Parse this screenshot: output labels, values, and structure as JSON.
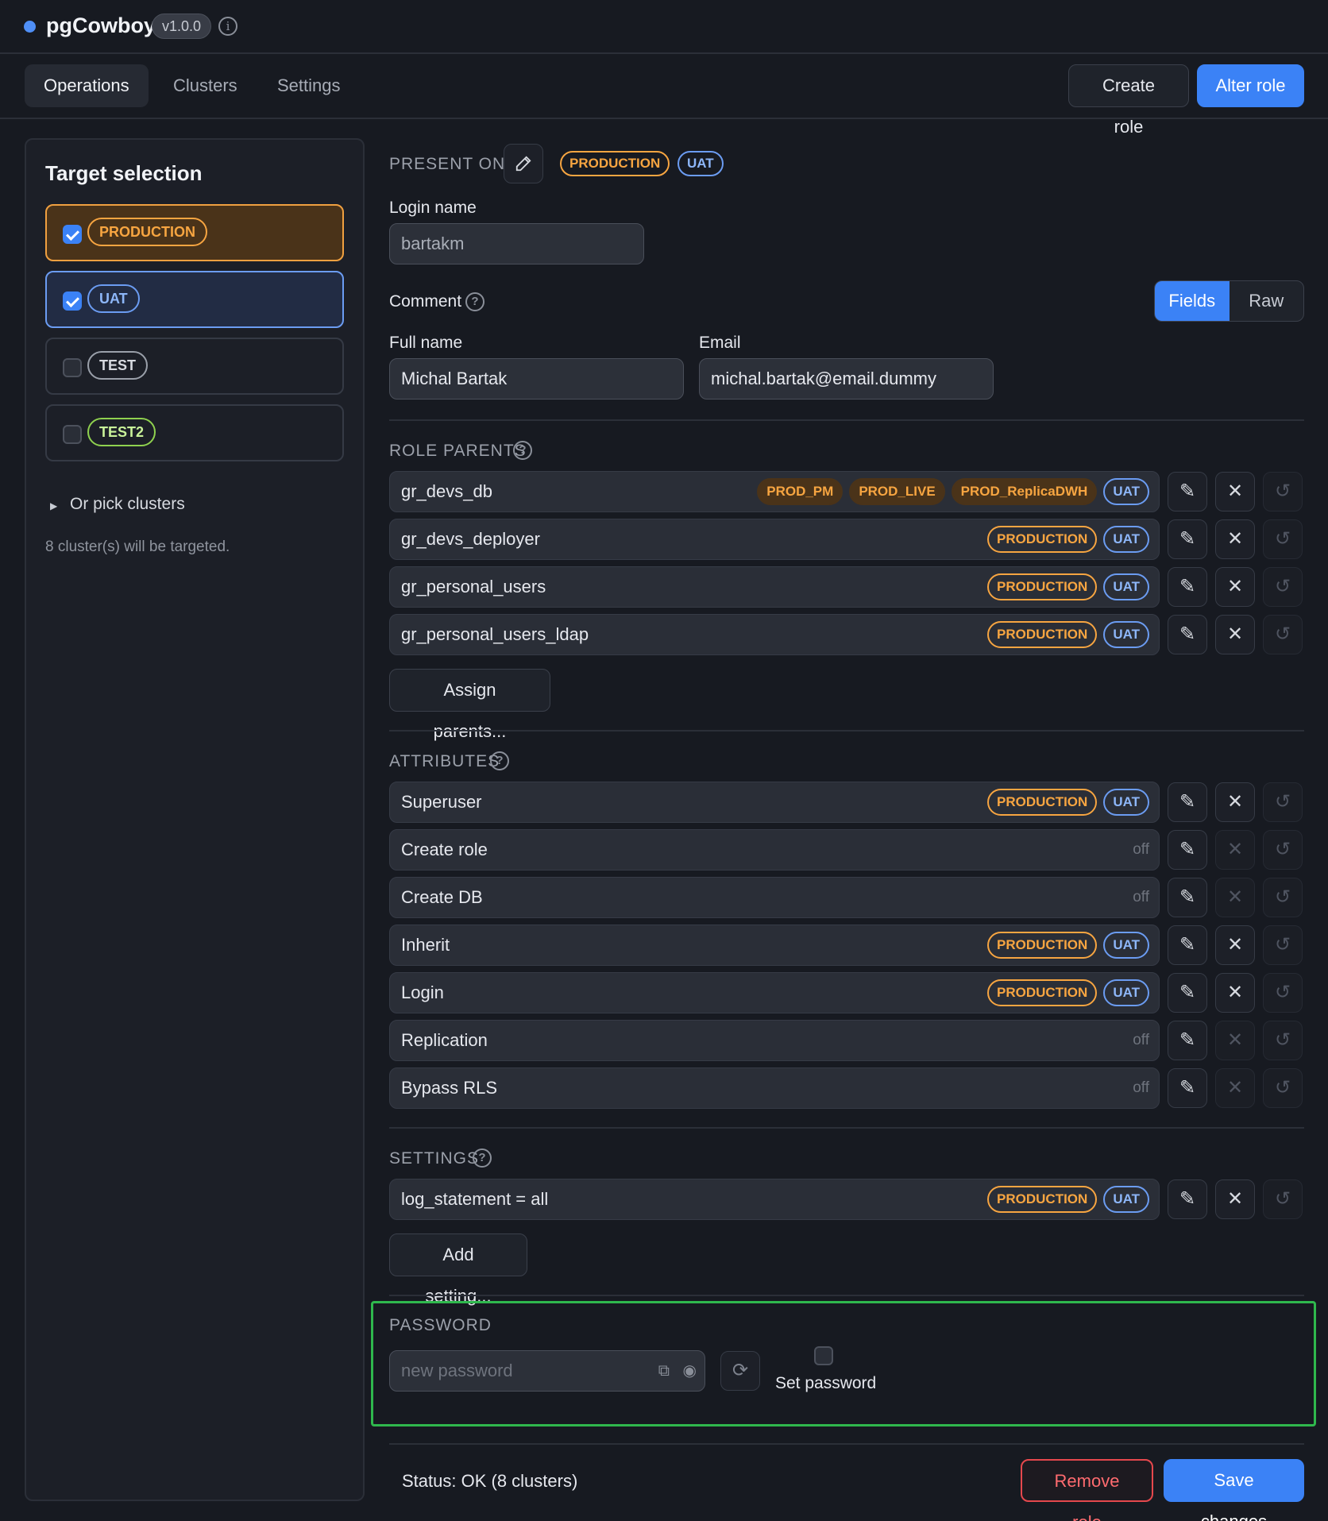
{
  "app": {
    "name": "pgCowboy",
    "version": "v1.0.0"
  },
  "nav": {
    "tabs": [
      "Operations",
      "Clusters",
      "Settings"
    ],
    "create_role": "Create role",
    "alter_role": "Alter role"
  },
  "target": {
    "title": "Target selection",
    "options": [
      {
        "label": "PRODUCTION",
        "checked": true
      },
      {
        "label": "UAT",
        "checked": true
      },
      {
        "label": "TEST",
        "checked": false
      },
      {
        "label": "TEST2",
        "checked": false
      }
    ],
    "pick_clusters": "Or pick clusters",
    "targeted_text": "8 cluster(s) will be targeted."
  },
  "form": {
    "present_on": {
      "label": "PRESENT ON",
      "chips": [
        "PRODUCTION",
        "UAT"
      ]
    },
    "login_name": {
      "label": "Login name",
      "value": "bartakm"
    },
    "comment": {
      "label": "Comment",
      "mode_fields": "Fields",
      "mode_raw": "Raw"
    },
    "full_name": {
      "label": "Full name",
      "value": "Michal Bartak"
    },
    "email": {
      "label": "Email",
      "value": "michal.bartak@email.dummy"
    }
  },
  "role_parents": {
    "label": "ROLE PARENTS",
    "items": [
      {
        "name": "gr_devs_db",
        "chips": [
          "PROD_PM",
          "PROD_LIVE",
          "PROD_ReplicaDWH",
          "UAT"
        ]
      },
      {
        "name": "gr_devs_deployer",
        "chips": [
          "PRODUCTION",
          "UAT"
        ]
      },
      {
        "name": "gr_personal_users",
        "chips": [
          "PRODUCTION",
          "UAT"
        ]
      },
      {
        "name": "gr_personal_users_ldap",
        "chips": [
          "PRODUCTION",
          "UAT"
        ]
      }
    ],
    "assign_button": "Assign parents..."
  },
  "attributes": {
    "label": "ATTRIBUTES",
    "items": [
      {
        "name": "Superuser",
        "chips": [
          "PRODUCTION",
          "UAT"
        ],
        "off": ""
      },
      {
        "name": "Create role",
        "chips": [],
        "off": "off"
      },
      {
        "name": "Create DB",
        "chips": [],
        "off": "off"
      },
      {
        "name": "Inherit",
        "chips": [
          "PRODUCTION",
          "UAT"
        ],
        "off": ""
      },
      {
        "name": "Login",
        "chips": [
          "PRODUCTION",
          "UAT"
        ],
        "off": ""
      },
      {
        "name": "Replication",
        "chips": [],
        "off": "off"
      },
      {
        "name": "Bypass RLS",
        "chips": [],
        "off": "off"
      }
    ]
  },
  "settings": {
    "label": "SETTINGS",
    "items": [
      {
        "name": "log_statement = all",
        "chips": [
          "PRODUCTION",
          "UAT"
        ]
      }
    ],
    "add_button": "Add setting..."
  },
  "password": {
    "label": "PASSWORD",
    "placeholder": "new password",
    "set_label": "Set password"
  },
  "footer": {
    "status": "Status: OK (8 clusters)",
    "remove": "Remove role",
    "save": "Save changes"
  },
  "colors": {
    "accent": "#3b82f6",
    "production": "#f7a541",
    "uat": "#6b9cf2",
    "test2": "#8fd14f",
    "danger": "#e5484d",
    "highlight": "#2fb84d"
  }
}
